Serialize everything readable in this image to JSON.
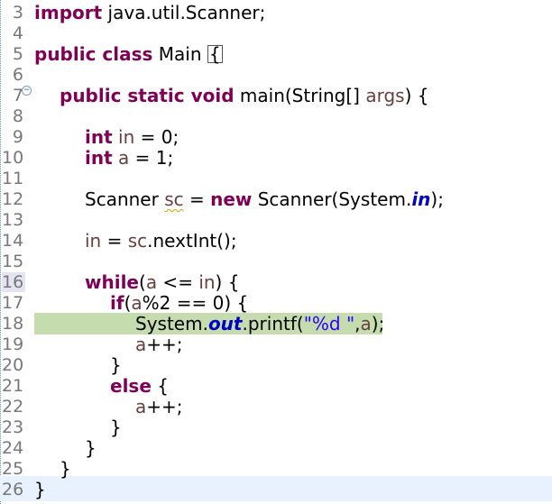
{
  "editor": {
    "line_numbers": [
      "3",
      "4",
      "5",
      "6",
      "7",
      "8",
      "9",
      "10",
      "11",
      "12",
      "13",
      "14",
      "15",
      "16",
      "17",
      "18",
      "19",
      "20",
      "21",
      "22",
      "23",
      "24",
      "25",
      "26"
    ],
    "tokens": {
      "l3_kw": "import",
      "l3_rest": " java.util.Scanner;",
      "l5_kw": "public class",
      "l5_rest": " Main ",
      "l5_brace": "{",
      "l7_kw": "public static void",
      "l7_a": " main(String[] ",
      "l7_var": "args",
      "l7_b": ") {",
      "l9_kw": "int",
      "l9_var": "in",
      "l9_rest": " = 0;",
      "l10_kw": "int",
      "l10_var": "a",
      "l10_rest": " = 1;",
      "l12_a": "Scanner ",
      "l12_var": "sc",
      "l12_b": " = ",
      "l12_kw": "new",
      "l12_c": " Scanner(System.",
      "l12_static": "in",
      "l12_d": ");",
      "l14_var1": "in",
      "l14_a": " = ",
      "l14_var2": "sc",
      "l14_b": ".nextInt();",
      "l16_kw": "while",
      "l16_a": "(",
      "l16_var1": "a",
      "l16_b": " <= ",
      "l16_var2": "in",
      "l16_c": ") {",
      "l17_kw": "if",
      "l17_a": "(",
      "l17_var": "a",
      "l17_b": "%2 == 0) {",
      "l18_a": "System.",
      "l18_static": "out",
      "l18_b": ".printf(",
      "l18_str": "\"%d \"",
      "l18_c": ",",
      "l18_var": "a",
      "l18_d": ");",
      "l19_var": "a",
      "l19_rest": "++;",
      "l20": "}",
      "l21_kw": "else",
      "l21_rest": " {",
      "l22_var": "a",
      "l22_rest": "++;",
      "l23": "}",
      "l24": "}",
      "l25": "}",
      "l26": "}"
    },
    "fold_icon": "collapse-icon",
    "colors": {
      "keyword": "#7f0055",
      "variable": "#6a3e3e",
      "static_field": "#0000c0",
      "string": "#2a00ff",
      "debug_highlight": "#c5dcae",
      "current_line": "#e8f2fe"
    }
  }
}
